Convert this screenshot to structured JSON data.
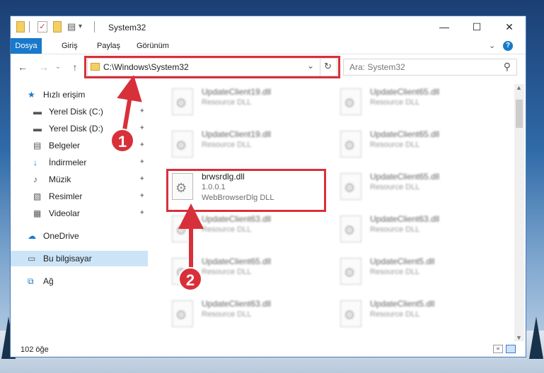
{
  "window": {
    "title": "System32",
    "minimize_glyph": "—",
    "maximize_glyph": "☐",
    "close_glyph": "✕"
  },
  "ribbon": {
    "tabs": [
      "Dosya",
      "Giriş",
      "Paylaş",
      "Görünüm"
    ],
    "help_glyph": "?",
    "expand_glyph": "⌄"
  },
  "address": {
    "path": "C:\\Windows\\System32",
    "dropdown_glyph": "⌄",
    "refresh_glyph": "↻",
    "back_glyph": "←",
    "forward_glyph": "→",
    "recent_glyph": "⌄",
    "up_glyph": "↑"
  },
  "search": {
    "placeholder": "Ara: System32",
    "icon_glyph": "⚲"
  },
  "sidebar": {
    "items": [
      {
        "label": "Hızlı erişim",
        "icon": "star-icon",
        "glyph": "★",
        "pinned": false
      },
      {
        "label": "Yerel Disk (C:)",
        "icon": "drive-icon",
        "glyph": "▬",
        "pinned": true
      },
      {
        "label": "Yerel Disk (D:)",
        "icon": "drive-icon",
        "glyph": "▬",
        "pinned": true
      },
      {
        "label": "Belgeler",
        "icon": "documents-icon",
        "glyph": "▤",
        "pinned": true
      },
      {
        "label": "İndirmeler",
        "icon": "download-icon",
        "glyph": "↓",
        "pinned": true
      },
      {
        "label": "Müzik",
        "icon": "music-icon",
        "glyph": "♪",
        "pinned": true
      },
      {
        "label": "Resimler",
        "icon": "pictures-icon",
        "glyph": "▧",
        "pinned": true
      },
      {
        "label": "Videolar",
        "icon": "videos-icon",
        "glyph": "▦",
        "pinned": true
      },
      {
        "label": "OneDrive",
        "icon": "cloud-icon",
        "glyph": "☁",
        "pinned": false
      },
      {
        "label": "Bu bilgisayar",
        "icon": "computer-icon",
        "glyph": "▭",
        "pinned": false,
        "selected": true
      },
      {
        "label": "Ağ",
        "icon": "network-icon",
        "glyph": "⧉",
        "pinned": false
      }
    ],
    "pin_glyph": "✦"
  },
  "files": [
    {
      "name": "UpdateClient19.dll",
      "line2": "Resource DLL",
      "line3": "",
      "blurred": true
    },
    {
      "name": "UpdateClient65.dll",
      "line2": "Resource DLL",
      "line3": "",
      "blurred": true
    },
    {
      "name": "UpdateClient19.dll",
      "line2": "Resource DLL",
      "line3": "",
      "blurred": true
    },
    {
      "name": "UpdateClient65.dll",
      "line2": "Resource DLL",
      "line3": "",
      "blurred": true
    },
    {
      "name": "brwsrdlg.dll",
      "line2": "1.0.0.1",
      "line3": "WebBrowserDlg DLL",
      "blurred": false
    },
    {
      "name": "UpdateClient65.dll",
      "line2": "Resource DLL",
      "line3": "",
      "blurred": true
    },
    {
      "name": "UpdateClient63.dll",
      "line2": "Resource DLL",
      "line3": "",
      "blurred": true
    },
    {
      "name": "UpdateClient63.dll",
      "line2": "Resource DLL",
      "line3": "",
      "blurred": true
    },
    {
      "name": "UpdateClient65.dll",
      "line2": "Resource DLL",
      "line3": "",
      "blurred": true
    },
    {
      "name": "UpdateClient5.dll",
      "line2": "Resource DLL",
      "line3": "",
      "blurred": true
    },
    {
      "name": "UpdateClient63.dll",
      "line2": "Resource DLL",
      "line3": "",
      "blurred": true
    },
    {
      "name": "UpdateClient5.dll",
      "line2": "Resource DLL",
      "line3": "",
      "blurred": true
    }
  ],
  "status": {
    "count": "102 öğe"
  },
  "callouts": [
    "1",
    "2"
  ],
  "colors": {
    "accent": "#1979ca",
    "highlight": "#d8303b",
    "selected_bg": "#cce4f7"
  }
}
